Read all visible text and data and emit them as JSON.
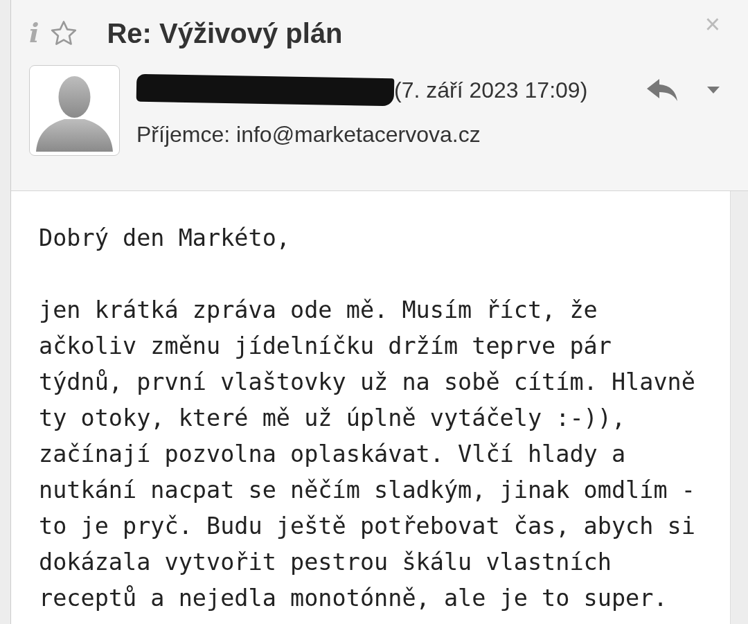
{
  "message": {
    "info_icon": "i",
    "close_icon": "×",
    "subject": "Re: Výživový plán",
    "starred": false,
    "sender_redacted": true,
    "date": "(7. září 2023 17:09)",
    "recipient_label": "Příjemce:",
    "recipient": "info@marketacervova.cz"
  },
  "body": [
    "Dobrý den Markéto,",
    "jen krátká zpráva ode mě. Musím říct, že ačkoliv změnu jídelníčku držím teprve pár týdnů, první vlaštovky už na sobě cítím. Hlavně ty otoky, které mě už úplně vytáčely :-)), začínají pozvolna oplaskávat. Vlčí hlady a nutkání nacpat se něčím sladkým, jinak omdlím - to je pryč. Budu ještě potřebovat čas, abych si dokázala vytvořit pestrou škálu vlastních receptů a nejedla monotónně, ale je to super."
  ]
}
